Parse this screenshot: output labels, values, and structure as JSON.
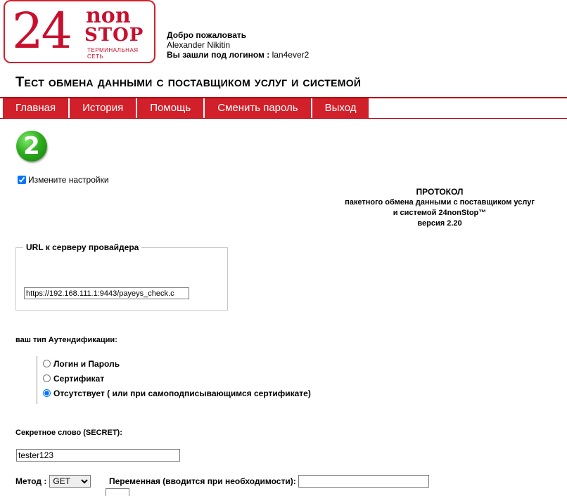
{
  "logo": {
    "number": "24",
    "line1": "non",
    "line2": "STOP",
    "tagline": "ТЕРМИНАЛЬНАЯ СЕТЬ"
  },
  "user": {
    "welcome": "Добро пожаловать",
    "name": "Alexander Nikitin",
    "login_label": "Вы зашли под логином :",
    "login": "lan4ever2"
  },
  "page": {
    "title": "Тест обмена данными с поставщиком услуг и системой"
  },
  "nav": {
    "items": [
      "Главная",
      "История",
      "Помощь",
      "Сменить пароль",
      "Выход"
    ]
  },
  "step": {
    "number": "2"
  },
  "settings": {
    "label": "Измените настройки",
    "checked": true
  },
  "protocol": {
    "line1": "ПРОТОКОЛ",
    "line2": "пакетного обмена данными с поставщиком услуг",
    "line3": "и системой 24nonStop™",
    "line4": "версия 2.20"
  },
  "url": {
    "legend": "URL к серверу провайдера",
    "value": "https://192.168.111.1:9443/payeys_check.c"
  },
  "auth": {
    "label": "ваш тип Аутендификации:",
    "options": [
      "Логин и Пароль",
      "Сертификат",
      "Отсутствует ( или при самоподписывающимся сертификате)"
    ],
    "selected_index": 2
  },
  "secret": {
    "label": "Секретное слово (SECRET):",
    "value": "tester123"
  },
  "method": {
    "label": "Метод :",
    "value": "GET"
  },
  "variable": {
    "label": "Переменная (вводится при необходимости):",
    "value": ""
  }
}
